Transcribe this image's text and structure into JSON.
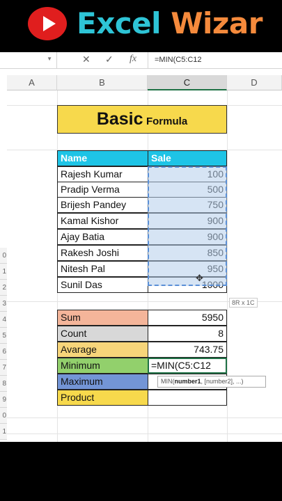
{
  "banner": {
    "title_part1": "Excel",
    "title_part2": "Wizar"
  },
  "formula_bar": {
    "cancel_icon": "✕",
    "confirm_icon": "✓",
    "fx_icon": "fx",
    "formula": "=MIN(C5:C12"
  },
  "columns": [
    "A",
    "B",
    "C",
    "D"
  ],
  "row_labels": [
    "0",
    "1",
    "2",
    "3",
    "4",
    "5",
    "6",
    "7",
    "8",
    "9",
    "0",
    "1"
  ],
  "title": {
    "main": "Basic",
    "sub": "Formula"
  },
  "table": {
    "headers": [
      "Name",
      "Sale"
    ],
    "rows": [
      {
        "name": "Rajesh Kumar",
        "sale": "100"
      },
      {
        "name": "Pradip Verma",
        "sale": "500"
      },
      {
        "name": "Brijesh Pandey",
        "sale": "750"
      },
      {
        "name": "Kamal Kishor",
        "sale": "900"
      },
      {
        "name": "Ajay Batia",
        "sale": "900"
      },
      {
        "name": "Rakesh Joshi",
        "sale": "850"
      },
      {
        "name": "Nitesh Pal",
        "sale": "950"
      },
      {
        "name": "Sunil Das",
        "sale": "1000"
      }
    ]
  },
  "selection_size": "8R x 1C",
  "summary": [
    {
      "label": "Sum",
      "value": "5950",
      "color": "#f4b59a"
    },
    {
      "label": "Count",
      "value": "8",
      "color": "#d8d8d8"
    },
    {
      "label": "Avarage",
      "value": "743.75",
      "color": "#f7d57a"
    },
    {
      "label": "Minimum",
      "value": "=MIN(C5:C12",
      "color": "#92d06c"
    },
    {
      "label": "Maximum",
      "value": "",
      "color": "#7395d6"
    },
    {
      "label": "Product",
      "value": "",
      "color": "#f7d94c"
    }
  ],
  "tooltip": {
    "prefix": "MIN(",
    "arg1": "number1",
    "rest": ", [number2], ...)"
  }
}
